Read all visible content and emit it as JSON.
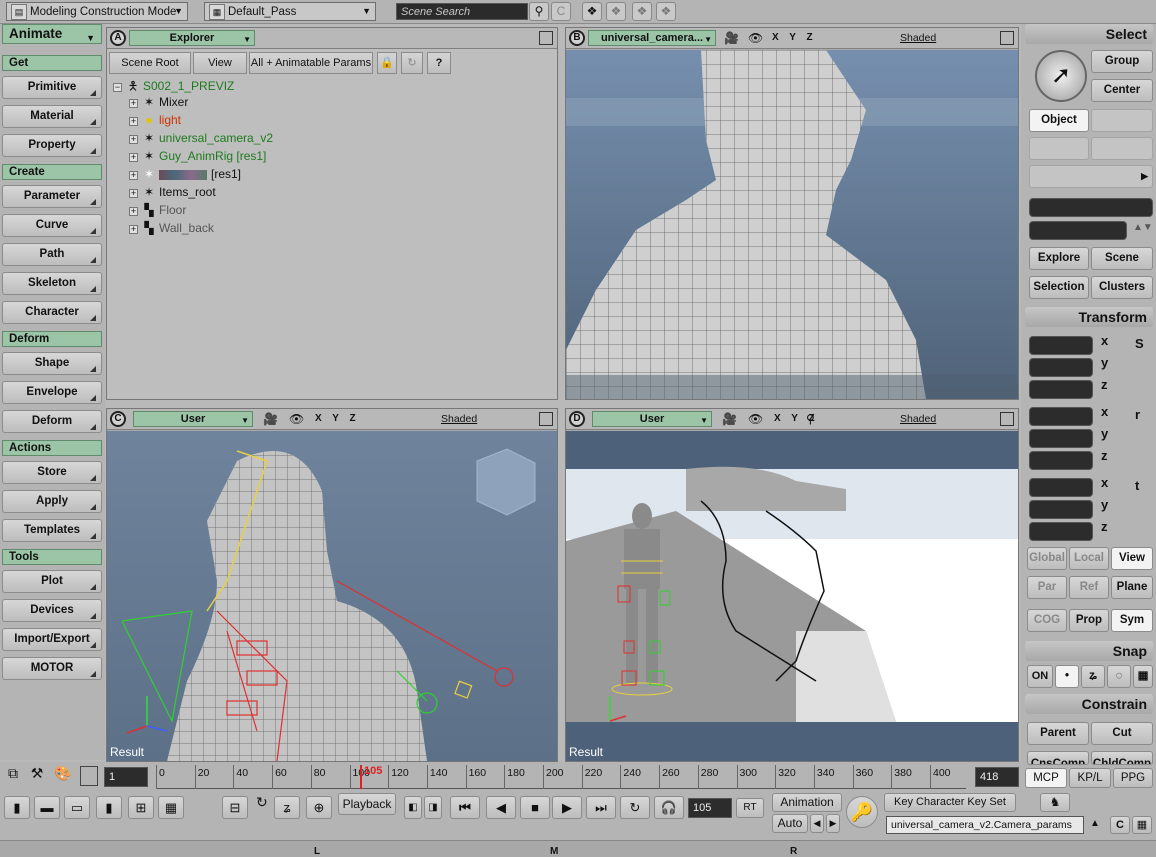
{
  "topbar": {
    "mode": "Modeling Construction Mode",
    "pass": "Default_Pass",
    "search_placeholder": "Scene Search"
  },
  "left_palette": {
    "title": "Animate",
    "sections": [
      {
        "header": "Get",
        "items": [
          "Primitive",
          "Material",
          "Property"
        ]
      },
      {
        "header": "Create",
        "items": [
          "Parameter",
          "Curve",
          "Path",
          "Skeleton",
          "Character"
        ]
      },
      {
        "header": "Deform",
        "items": [
          "Shape",
          "Envelope",
          "Deform"
        ]
      },
      {
        "header": "Actions",
        "items": [
          "Store",
          "Apply",
          "Templates"
        ]
      },
      {
        "header": "Tools",
        "items": [
          "Plot",
          "Devices",
          "Import/Export",
          "MOTOR"
        ]
      }
    ]
  },
  "explorer": {
    "letter": "A",
    "title": "Explorer",
    "toolbar": [
      "Scene Root",
      "View",
      "All + Animatable Params"
    ],
    "root": "S002_1_PREVIZ",
    "nodes": [
      {
        "label": "Mixer",
        "color": "#111111"
      },
      {
        "label": "light",
        "color": "#cc3300"
      },
      {
        "label": "universal_camera_v2",
        "color": "#1e7a1e"
      },
      {
        "label": "Guy_AnimRig  [res1]",
        "color": "#1e7a1e"
      },
      {
        "label": "[res1]",
        "color": "#111111"
      },
      {
        "label": "Items_root",
        "color": "#111111"
      },
      {
        "label": "Floor",
        "color": "#555555"
      },
      {
        "label": "Wall_back",
        "color": "#555555"
      }
    ]
  },
  "viewports": {
    "b": {
      "letter": "B",
      "camera": "universal_camera...",
      "axes": "X Y Z",
      "mode": "Shaded"
    },
    "c": {
      "letter": "C",
      "camera": "User",
      "axes": "X Y Z",
      "mode": "Shaded",
      "result": "Result"
    },
    "d": {
      "letter": "D",
      "camera": "User",
      "axes": "X Y Z",
      "mode": "Shaded",
      "result": "Result"
    }
  },
  "right_palette": {
    "select": {
      "title": "Select",
      "group": "Group",
      "center": "Center",
      "object": "Object",
      "explore": "Explore",
      "scene": "Scene",
      "selection": "Selection",
      "clusters": "Clusters"
    },
    "transform": {
      "title": "Transform",
      "axes": [
        "x",
        "y",
        "z"
      ],
      "side_icons": [
        "S",
        "r",
        "t"
      ],
      "spaces": [
        "Global",
        "Local",
        "View"
      ],
      "refs": [
        "Par",
        "Ref",
        "Plane"
      ],
      "extra": [
        "COG",
        "Prop",
        "Sym"
      ]
    },
    "snap": {
      "title": "Snap",
      "on": "ON"
    },
    "constrain": {
      "title": "Constrain",
      "parent": "Parent",
      "cut": "Cut",
      "cns": "CnsComp",
      "chld": "ChldComp"
    }
  },
  "timeline": {
    "start": "1",
    "end": "418",
    "current": "105",
    "ticks": [
      "0",
      "20",
      "40",
      "60",
      "80",
      "100",
      "120",
      "140",
      "160",
      "180",
      "200",
      "220",
      "240",
      "260",
      "280",
      "300",
      "320",
      "340",
      "360",
      "380",
      "400"
    ],
    "tabs": [
      "MCP",
      "KP/L",
      "PPG"
    ]
  },
  "bottom": {
    "playback": "Playback",
    "frame": "105",
    "rt": "RT",
    "animation": "Animation",
    "auto": "Auto",
    "keyset": "Key Character Key Set",
    "params": "universal_camera_v2.Camera_params",
    "markers": [
      "L",
      "M",
      "R"
    ]
  }
}
